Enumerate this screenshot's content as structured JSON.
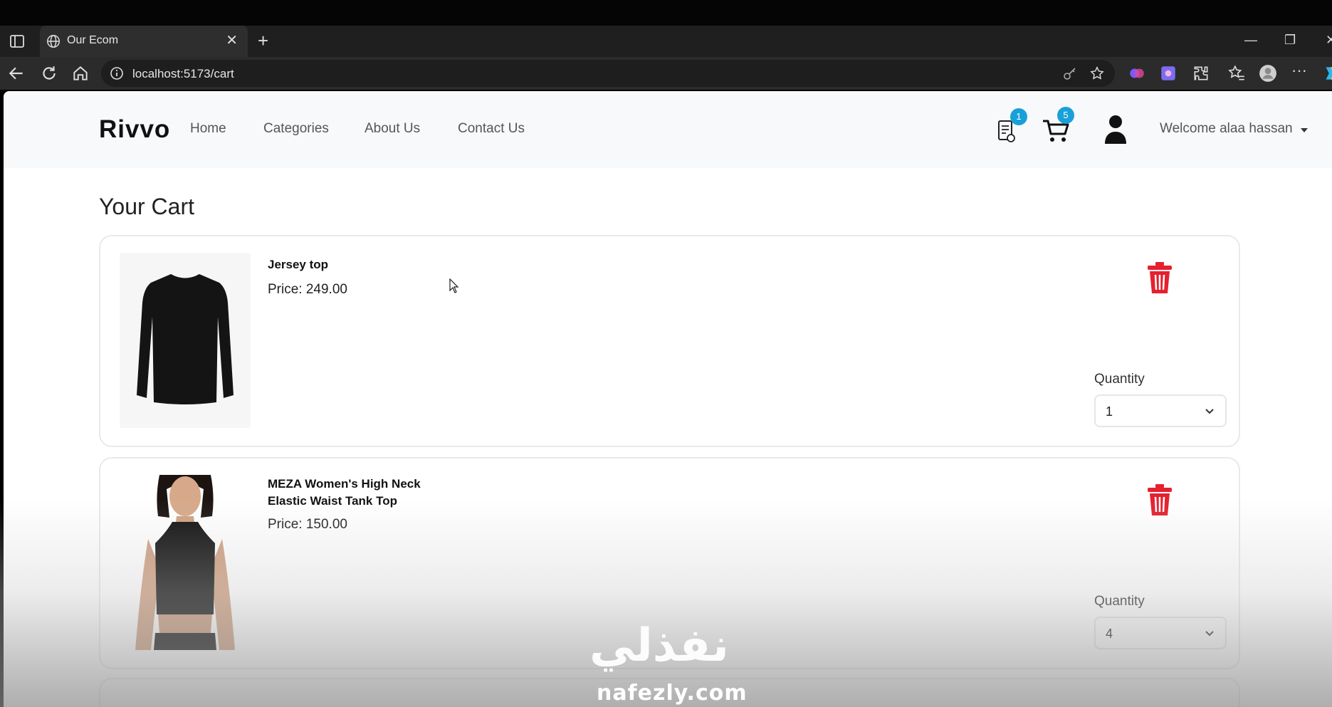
{
  "browser": {
    "tab_title": "Our Ecom",
    "url": "localhost:5173/cart"
  },
  "navbar": {
    "brand": "Rivvo",
    "links": [
      "Home",
      "Categories",
      "About Us",
      "Contact Us"
    ],
    "orders_badge": "1",
    "cart_badge": "5",
    "welcome": "Welcome alaa hassan"
  },
  "page": {
    "title": "Your Cart"
  },
  "cart_items": [
    {
      "name": "Jersey top",
      "price": "Price: 249.00",
      "quantity_label": "Quantity",
      "quantity": "1"
    },
    {
      "name": "MEZA Women's High Neck Elastic Waist Tank Top",
      "price": "Price: 150.00",
      "quantity_label": "Quantity",
      "quantity": "4"
    }
  ],
  "watermark": {
    "arabic": "نفذلي",
    "latin": "nafezly.com"
  },
  "colors": {
    "trash": "#e5212f",
    "badge": "#1aa0d8"
  }
}
